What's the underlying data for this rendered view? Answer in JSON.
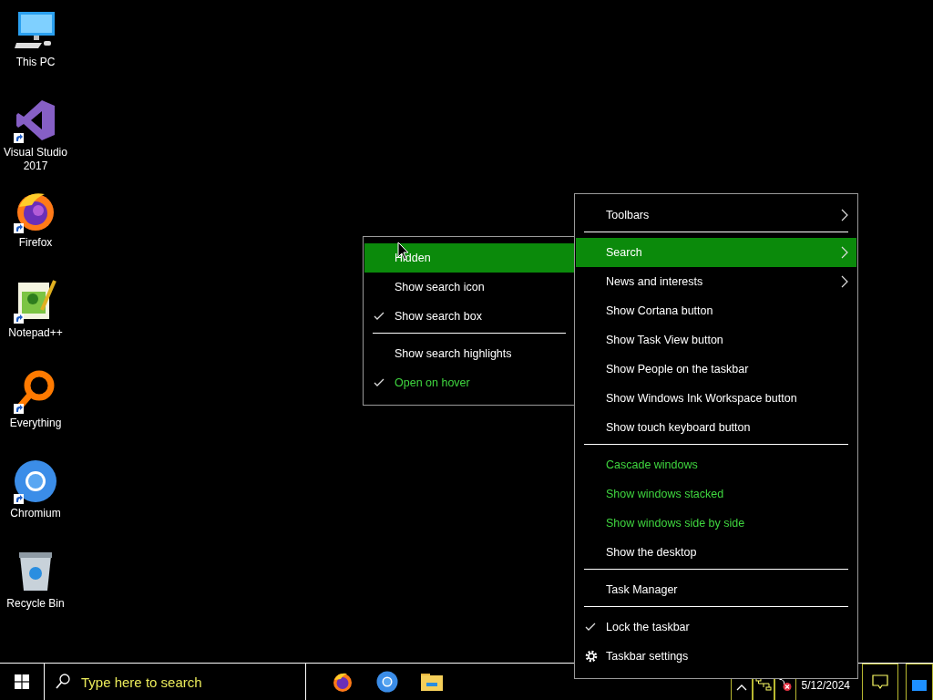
{
  "desktop_icons": [
    {
      "label": "This PC",
      "kind": "computer",
      "shortcut": false
    },
    {
      "label": "Visual Studio 2017",
      "kind": "visualstudio",
      "shortcut": true
    },
    {
      "label": "Firefox",
      "kind": "firefox",
      "shortcut": true
    },
    {
      "label": "Notepad++",
      "kind": "notepad",
      "shortcut": true
    },
    {
      "label": "Everything",
      "kind": "everything",
      "shortcut": true
    },
    {
      "label": "Chromium",
      "kind": "chromium",
      "shortcut": true
    },
    {
      "label": "Recycle Bin",
      "kind": "recyclebin",
      "shortcut": false
    }
  ],
  "search_submenu": {
    "groups": [
      {
        "items": [
          {
            "label": "Hidden",
            "selected": true,
            "checked": false,
            "disabled": false
          },
          {
            "label": "Show search icon",
            "selected": false,
            "checked": false,
            "disabled": false
          },
          {
            "label": "Show search box",
            "selected": false,
            "checked": true,
            "disabled": false
          }
        ]
      },
      {
        "items": [
          {
            "label": "Show search highlights",
            "selected": false,
            "checked": false,
            "disabled": false
          },
          {
            "label": "Open on hover",
            "selected": false,
            "checked": true,
            "disabled": true
          }
        ]
      }
    ]
  },
  "taskbar_menu": {
    "groups": [
      {
        "items": [
          {
            "label": "Toolbars",
            "selected": false,
            "checked": false,
            "disabled": false,
            "submenu": true
          }
        ]
      },
      {
        "items": [
          {
            "label": "Search",
            "selected": true,
            "checked": false,
            "disabled": false,
            "submenu": true
          },
          {
            "label": "News and interests",
            "selected": false,
            "checked": false,
            "disabled": false,
            "submenu": true
          },
          {
            "label": "Show Cortana button",
            "selected": false,
            "checked": false,
            "disabled": false,
            "submenu": false
          },
          {
            "label": "Show Task View button",
            "selected": false,
            "checked": false,
            "disabled": false,
            "submenu": false
          },
          {
            "label": "Show People on the taskbar",
            "selected": false,
            "checked": false,
            "disabled": false,
            "submenu": false
          },
          {
            "label": "Show Windows Ink Workspace button",
            "selected": false,
            "checked": false,
            "disabled": false,
            "submenu": false
          },
          {
            "label": "Show touch keyboard button",
            "selected": false,
            "checked": false,
            "disabled": false,
            "submenu": false
          }
        ]
      },
      {
        "items": [
          {
            "label": "Cascade windows",
            "selected": false,
            "checked": false,
            "disabled": true,
            "submenu": false
          },
          {
            "label": "Show windows stacked",
            "selected": false,
            "checked": false,
            "disabled": true,
            "submenu": false
          },
          {
            "label": "Show windows side by side",
            "selected": false,
            "checked": false,
            "disabled": true,
            "submenu": false
          },
          {
            "label": "Show the desktop",
            "selected": false,
            "checked": false,
            "disabled": false,
            "submenu": false
          }
        ]
      },
      {
        "items": [
          {
            "label": "Task Manager",
            "selected": false,
            "checked": false,
            "disabled": false,
            "submenu": false
          }
        ]
      },
      {
        "items": [
          {
            "label": "Lock the taskbar",
            "selected": false,
            "checked": true,
            "disabled": false,
            "submenu": false
          },
          {
            "label": "Taskbar settings",
            "selected": false,
            "checked": false,
            "disabled": false,
            "submenu": false,
            "kind": "settings"
          }
        ]
      }
    ]
  },
  "taskbar": {
    "search": {
      "placeholder": "Type here to search"
    },
    "pinned": [
      {
        "kind": "firefox"
      },
      {
        "kind": "chromium"
      },
      {
        "kind": "explorer"
      }
    ],
    "tray": {
      "date": "5/12/2024"
    }
  }
}
